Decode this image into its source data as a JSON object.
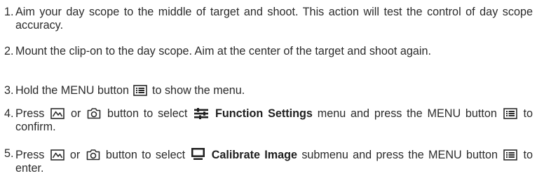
{
  "steps": [
    {
      "number": "1.",
      "text": "Aim your day scope to the middle of target and shoot. This action will test the control of day scope accuracy."
    },
    {
      "number": "2.",
      "text": "Mount the clip-on to the day scope. Aim at the center of the target and shoot again."
    },
    {
      "number": "3.",
      "pre": "Hold the MENU button",
      "icon": "menu-icon",
      "post": "to show the menu."
    },
    {
      "number": "4.",
      "a": "Press",
      "icon_1": "image-icon",
      "b": "or",
      "icon_2": "camera-icon",
      "c": "button to select",
      "icon_3": "function-settings-icon",
      "bold": "Function Settings",
      "d": "menu and press the MENU button",
      "icon_4": "menu-icon",
      "e": "to confirm."
    },
    {
      "number": "5.",
      "a": "Press",
      "icon_1": "image-icon",
      "b": "or",
      "icon_2": "camera-icon",
      "c": "button to select",
      "icon_3": "calibrate-image-icon",
      "bold": "Calibrate Image",
      "d": "submenu and press the MENU button",
      "icon_4": "menu-icon",
      "e": "to enter."
    }
  ]
}
